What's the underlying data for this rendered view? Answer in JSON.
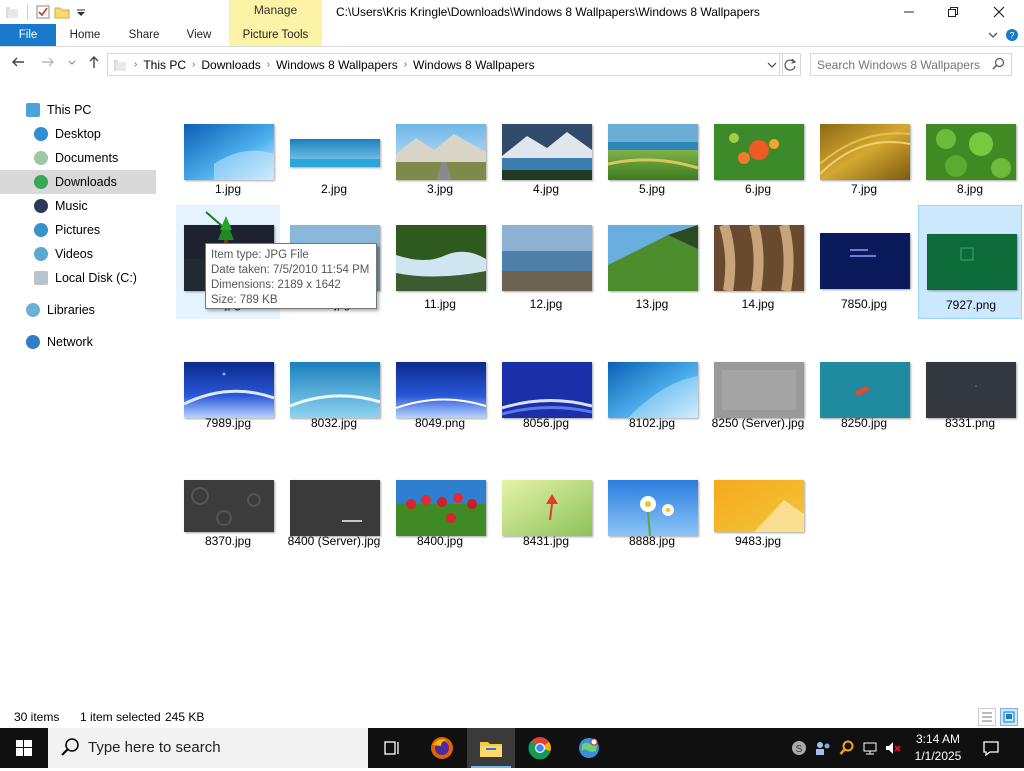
{
  "window": {
    "title": "C:\\Users\\Kris Kringle\\Downloads\\Windows 8 Wallpapers\\Windows 8 Wallpapers",
    "contextual_group": "Manage"
  },
  "ribbon": {
    "tabs": [
      "File",
      "Home",
      "Share",
      "View",
      "Picture Tools"
    ]
  },
  "address": {
    "breadcrumb": [
      "This PC",
      "Downloads",
      "Windows 8 Wallpapers",
      "Windows 8 Wallpapers"
    ]
  },
  "search": {
    "placeholder": "Search Windows 8 Wallpapers"
  },
  "nav": {
    "items": [
      "This PC",
      "Desktop",
      "Documents",
      "Downloads",
      "Music",
      "Pictures",
      "Videos",
      "Local Disk (C:)",
      "Libraries",
      "Network"
    ],
    "selected": "Downloads"
  },
  "files": [
    "1.jpg",
    "2.jpg",
    "3.jpg",
    "4.jpg",
    "5.jpg",
    "6.jpg",
    "7.jpg",
    "8.jpg",
    "9.jpg",
    "10.jpg",
    "11.jpg",
    "12.jpg",
    "13.jpg",
    "14.jpg",
    "7850.jpg",
    "7927.png",
    "7989.jpg",
    "8032.jpg",
    "8049.png",
    "8056.jpg",
    "8102.jpg",
    "8250 (Server).jpg",
    "8250.jpg",
    "8331.png",
    "8370.jpg",
    "8400 (Server).jpg",
    "8400.jpg",
    "8431.jpg",
    "8888.jpg",
    "9483.jpg"
  ],
  "selected_file": "7927.png",
  "tooltip": {
    "item_type": "Item type: JPG File",
    "date_taken": "Date taken: 7/5/2010 11:54 PM",
    "dimensions": "Dimensions: 2189 x 1642",
    "size": "Size: 789 KB"
  },
  "status": {
    "count": "30 items",
    "selection": "1 item selected",
    "size": "245 KB"
  },
  "taskbar": {
    "search_text": "Type here to search",
    "time": "3:14 AM",
    "date": "1/1/2025"
  },
  "colors": {
    "accent": "#1979ca",
    "selection": "#cce8ff",
    "manage_tab": "#fcf3a7",
    "taskbar": "#101010"
  }
}
